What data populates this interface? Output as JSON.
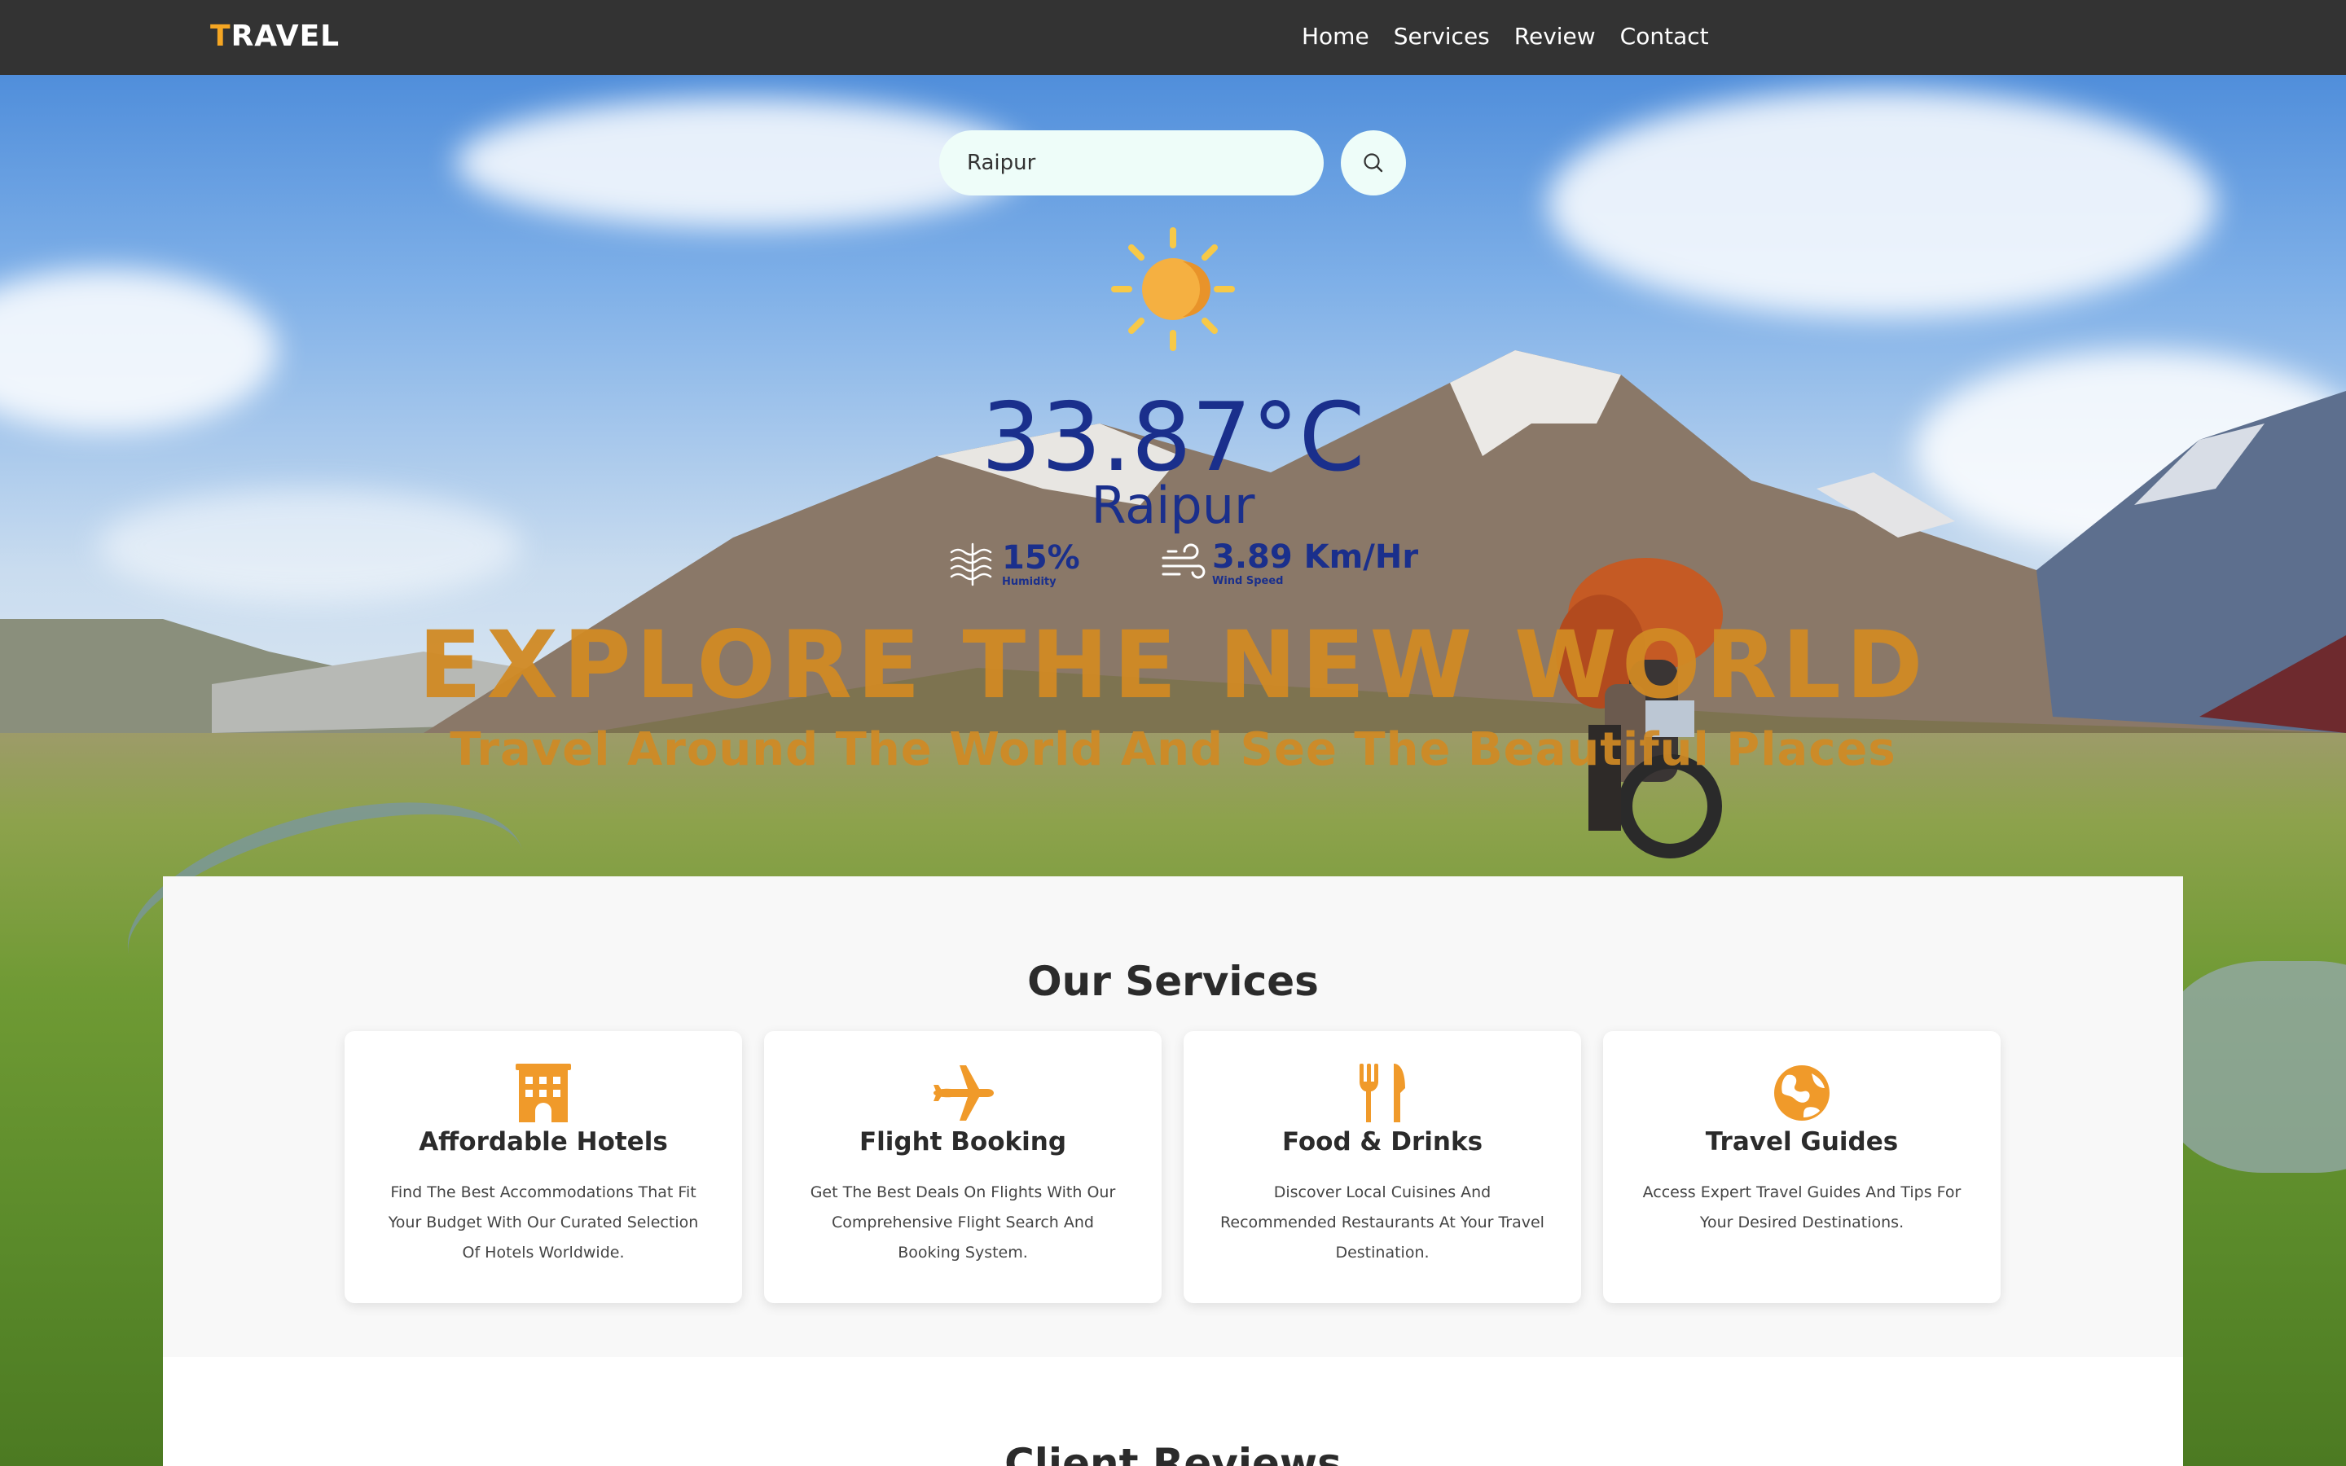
{
  "nav": {
    "logo_first": "T",
    "logo_rest": "RAVEL",
    "links": [
      "Home",
      "Services",
      "Review",
      "Contact"
    ]
  },
  "search": {
    "value": "Raipur",
    "button_icon": "search-icon"
  },
  "weather": {
    "icon": "sun-icon",
    "temperature": "33.87°C",
    "city": "Raipur",
    "humidity_value": "15%",
    "humidity_label": "Humidity",
    "wind_value": "3.89 Km/Hr",
    "wind_label": "Wind Speed"
  },
  "hero": {
    "title": "EXPLORE THE NEW WORLD",
    "subtitle": "Travel Around The World And See The Beautiful Places"
  },
  "services": {
    "title": "Our Services",
    "items": [
      {
        "icon": "hotel-icon",
        "title": "Affordable Hotels",
        "description": "Find The Best Accommodations That Fit Your Budget With Our Curated Selection Of Hotels Worldwide."
      },
      {
        "icon": "plane-icon",
        "title": "Flight Booking",
        "description": "Get The Best Deals On Flights With Our Comprehensive Flight Search And Booking System."
      },
      {
        "icon": "utensils-icon",
        "title": "Food & Drinks",
        "description": "Discover Local Cuisines And Recommended Restaurants At Your Travel Destination."
      },
      {
        "icon": "globe-icon",
        "title": "Travel Guides",
        "description": "Access Expert Travel Guides And Tips For Your Desired Destinations."
      }
    ]
  },
  "reviews": {
    "title": "Client Reviews"
  },
  "colors": {
    "accent": "#f5a623",
    "hero_text": "#d18a24",
    "weather_text": "#1a2f8c",
    "nav_bg": "#333333"
  }
}
